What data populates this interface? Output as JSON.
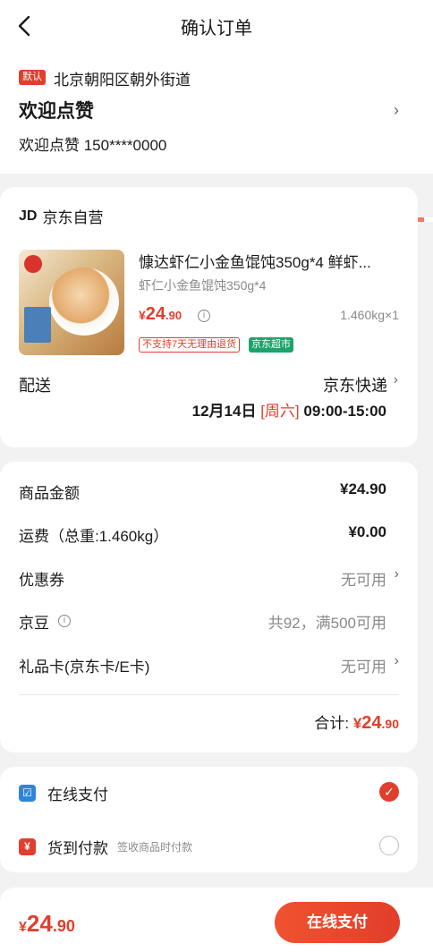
{
  "header": {
    "title": "确认订单",
    "back_icon": "chevron-left-icon"
  },
  "address": {
    "badge": "默认",
    "line": "北京朝阳区朝外街道",
    "name": "欢迎点赞",
    "contact": "欢迎点赞  150****0000",
    "chevron": "›"
  },
  "shop": {
    "logo": "JD",
    "name": "京东自营"
  },
  "product": {
    "title": "慷达虾仁小金鱼馄饨350g*4 鲜虾...",
    "subtitle": "虾仁小金鱼馄饨350g*4",
    "price_symbol": "¥",
    "price_int": "24",
    "price_dec": ".90",
    "quantity": "1.460kg×1",
    "tag_noreturn": "不支持7天无理由退货",
    "tag_market": "京东超市"
  },
  "shipping": {
    "label": "配送",
    "method": "京东快递",
    "date": "12月14日",
    "weekday": "[周六]",
    "time": "09:00-15:00"
  },
  "summary": {
    "goods_label": "商品金额",
    "goods_value": "¥24.90",
    "freight_label": "运费（总重:1.460kg）",
    "freight_value": "¥0.00",
    "coupon_label": "优惠券",
    "coupon_value": "无可用",
    "bean_label": "京豆",
    "bean_value": "共92，满500可用",
    "gift_label": "礼品卡(京东卡/E卡)",
    "gift_value": "无可用",
    "total_label": "合计:",
    "total_symbol": "¥",
    "total_int": "24",
    "total_dec": ".90"
  },
  "payment": {
    "online_label": "在线支付",
    "cod_label": "货到付款",
    "cod_note": "签收商品时付款",
    "selected": "online"
  },
  "footer": {
    "price_symbol": "¥",
    "price_int": "24",
    "price_dec": ".90",
    "pay_button": "在线支付"
  },
  "colors": {
    "accent": "#e23e2c",
    "green_tag": "#1ca36c",
    "online_icon": "#2d86d9"
  }
}
